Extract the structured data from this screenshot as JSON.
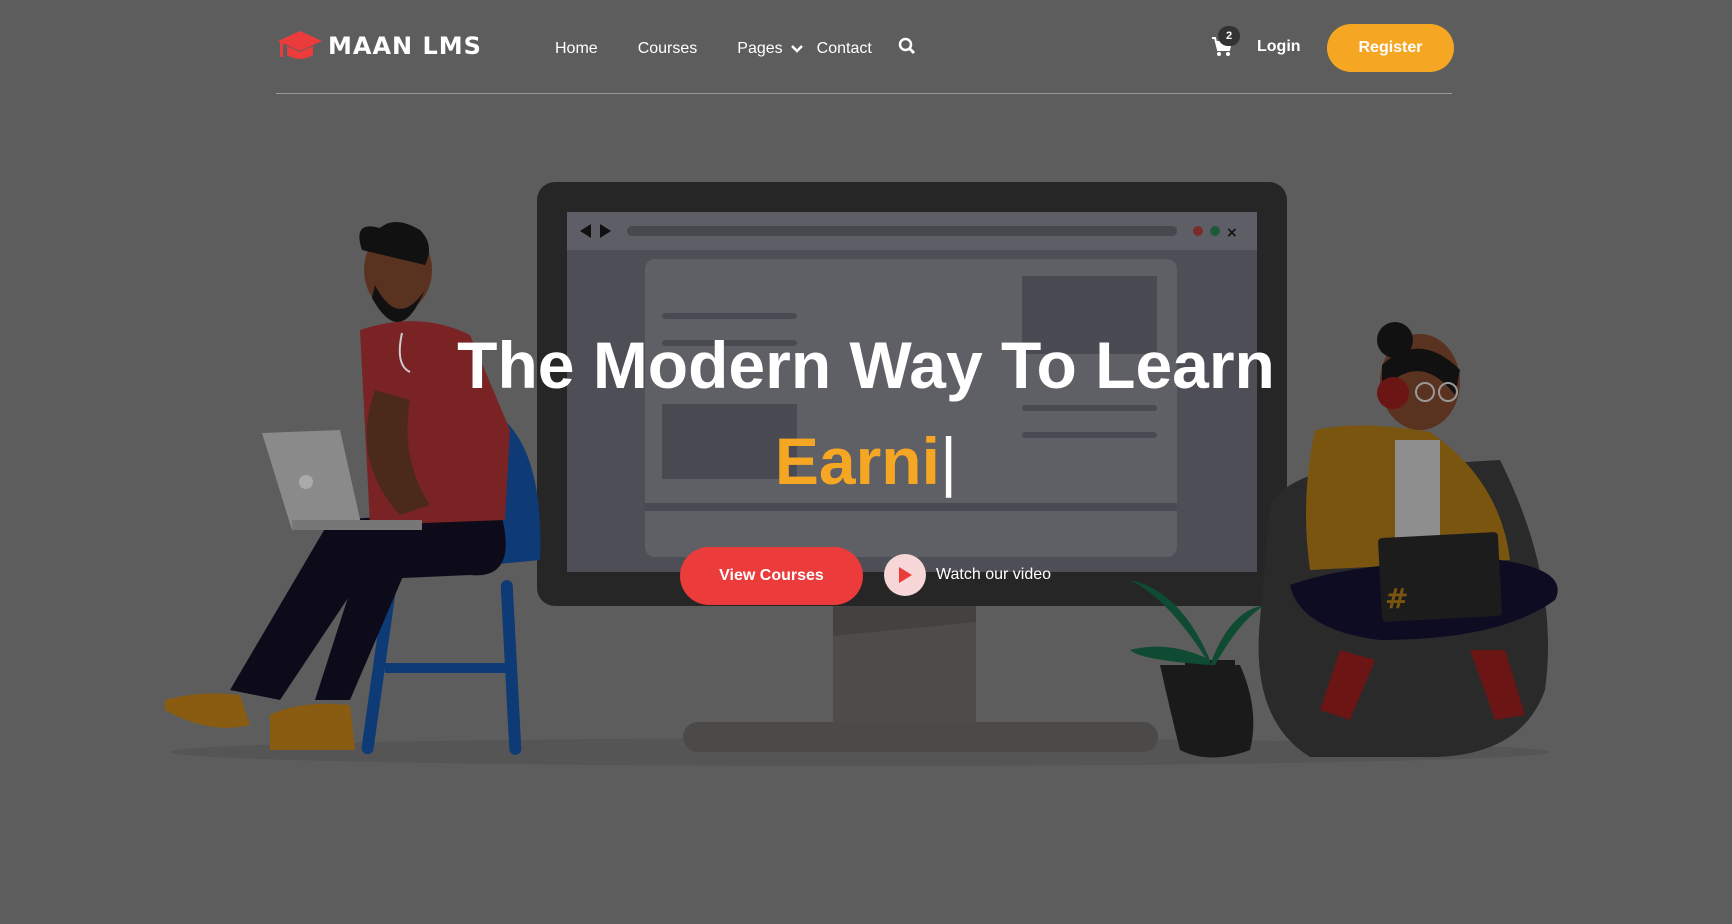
{
  "brand": {
    "name": "MAAN LMS",
    "logo_icon": "graduation-cap-icon",
    "accent": "#ec3b3b"
  },
  "nav": {
    "items": [
      {
        "label": "Home"
      },
      {
        "label": "Courses"
      },
      {
        "label": "Pages"
      },
      {
        "label": "Contact"
      }
    ],
    "search_icon": "search-icon",
    "cart": {
      "icon": "cart-icon",
      "count": "2"
    },
    "login_label": "Login",
    "register_label": "Register"
  },
  "hero": {
    "title": "The Modern Way To Learn",
    "typed_word": "Earni",
    "cursor": "|",
    "primary_button": "View Courses",
    "video_link": "Watch our video",
    "play_icon": "play-icon"
  },
  "colors": {
    "background": "#5d5d5d",
    "orange": "#f5a623",
    "red": "#ec3b3b"
  }
}
